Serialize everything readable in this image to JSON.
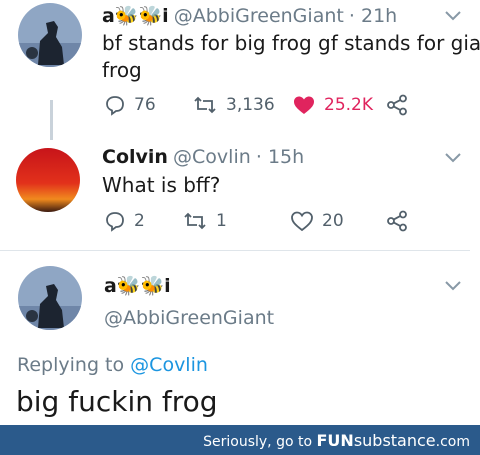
{
  "tweet1": {
    "display_name": "a🐝🐝i",
    "handle": "@AbbiGreenGiant",
    "time": "· 21h",
    "text_line1": "bf stands for big frog gf stands for giant",
    "text_line2": "frog",
    "replies": "76",
    "retweets": "3,136",
    "likes": "25.2K",
    "liked": true
  },
  "tweet2": {
    "display_name": "Colvin",
    "handle": "@Covlin",
    "time": "· 15h",
    "text": "What is bff?",
    "replies": "2",
    "retweets": "1",
    "likes": "20"
  },
  "tweet3": {
    "display_name": "a🐝🐝i",
    "handle": "@AbbiGreenGiant",
    "replying_prefix": "Replying to",
    "replying_to": "@Covlin",
    "text": "big fuckin frog"
  },
  "footer": {
    "prefix": "Seriously, go to",
    "brand_a": "FUN",
    "brand_b": "substance",
    "suffix": ".com"
  },
  "colors": {
    "like_red": "#e0245e",
    "link_blue": "#1b95e0",
    "footer_bg": "#2b5a8b"
  },
  "icons": [
    "reply-icon",
    "retweet-icon",
    "heart-icon",
    "share-icon",
    "chevron-down-icon"
  ]
}
